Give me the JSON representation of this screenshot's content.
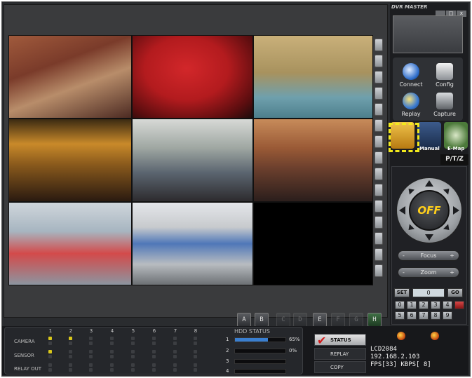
{
  "window": {
    "brand": "DVR MASTER",
    "controls": [
      "_",
      "□",
      "x"
    ]
  },
  "functions": [
    {
      "label": "Connect",
      "icon": "connect-icon"
    },
    {
      "label": "Config",
      "icon": "config-icon"
    },
    {
      "label": "Replay",
      "icon": "replay-icon"
    },
    {
      "label": "Capture",
      "icon": "capture-icon"
    }
  ],
  "tabs": [
    {
      "label": "",
      "icon": "monitor-icon"
    },
    {
      "label": "Manual",
      "icon": "manual-icon"
    },
    {
      "label": "E-Map",
      "icon": "emap-icon"
    }
  ],
  "ptz": {
    "tab_label": "P/T/Z",
    "center_label": "OFF",
    "focus_label": "Focus",
    "zoom_label": "Zoom",
    "minus": "-",
    "plus": "+",
    "set_label": "SET",
    "go_label": "GO",
    "preset_value": "0",
    "keypad": [
      "0",
      "1",
      "2",
      "3",
      "4",
      "5",
      "6",
      "7",
      "8",
      "9"
    ]
  },
  "layout_buttons": [
    "A",
    "B",
    "C",
    "D",
    "E",
    "F",
    "G",
    "H"
  ],
  "io": {
    "channels": [
      "1",
      "2",
      "3",
      "4",
      "5",
      "6",
      "7",
      "8"
    ],
    "rows": [
      "CAMERA",
      "SENSOR",
      "RELAY OUT"
    ]
  },
  "hdd": {
    "title": "HDD STATUS",
    "disks": [
      {
        "num": "1",
        "percent": "65%",
        "fill": 0.65
      },
      {
        "num": "2",
        "percent": "0%",
        "fill": 0.0
      },
      {
        "num": "3",
        "percent": "",
        "fill": 0.0
      },
      {
        "num": "4",
        "percent": "",
        "fill": 0.0
      }
    ]
  },
  "modes": [
    "STATUS",
    "REPLAY",
    "COPY"
  ],
  "info": {
    "device": "LCD2084",
    "ip": "192.168.2.103",
    "fps_label": "FPS[33]",
    "kbps_label": "KBPS[   8]"
  }
}
